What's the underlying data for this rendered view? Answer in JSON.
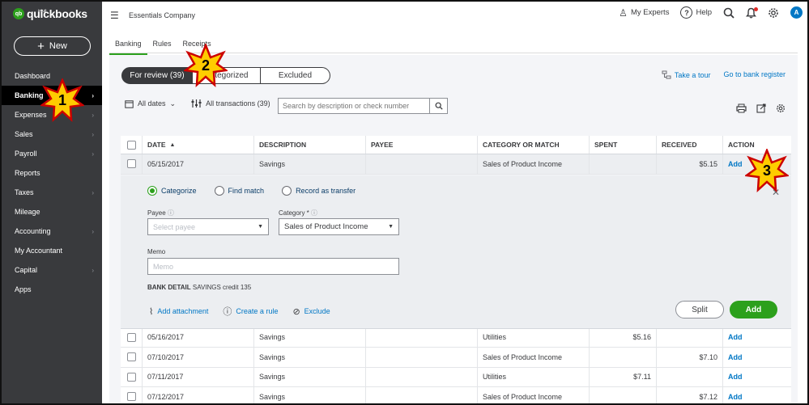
{
  "app": {
    "logo_small": "intuit",
    "logo_text": "quickbooks",
    "logo_mark": "qb"
  },
  "sidebar": {
    "new_label": "New",
    "items": [
      {
        "label": "Dashboard",
        "chevron": false
      },
      {
        "label": "Banking",
        "chevron": true,
        "active": true
      },
      {
        "label": "Expenses",
        "chevron": true
      },
      {
        "label": "Sales",
        "chevron": true
      },
      {
        "label": "Payroll",
        "chevron": true
      },
      {
        "label": "Reports",
        "chevron": false
      },
      {
        "label": "Taxes",
        "chevron": true
      },
      {
        "label": "Mileage",
        "chevron": false
      },
      {
        "label": "Accounting",
        "chevron": true
      },
      {
        "label": "My Accountant",
        "chevron": false
      },
      {
        "label": "Capital",
        "chevron": true
      },
      {
        "label": "Apps",
        "chevron": false
      }
    ]
  },
  "topbar": {
    "company": "Essentials Company",
    "my_experts": "My Experts",
    "help": "Help",
    "avatar_letter": "A"
  },
  "tabs": [
    "Banking",
    "Rules",
    "Receipts"
  ],
  "segments": {
    "for_review": "For review (39)",
    "categorized": "Categorized",
    "excluded": "Excluded"
  },
  "links": {
    "take_tour": "Take a tour",
    "bank_register": "Go to bank register"
  },
  "filters": {
    "all_dates": "All dates",
    "all_transactions": "All transactions (39)",
    "search_placeholder": "Search by description or check number"
  },
  "table": {
    "headers": {
      "date": "DATE",
      "description": "DESCRIPTION",
      "payee": "PAYEE",
      "category": "CATEGORY OR MATCH",
      "spent": "SPENT",
      "received": "RECEIVED",
      "action": "ACTION"
    },
    "selected_row": {
      "date": "05/15/2017",
      "description": "Savings",
      "payee": "",
      "category": "Sales of Product Income",
      "spent": "",
      "received": "$5.15",
      "action": "Add"
    },
    "rows": [
      {
        "date": "05/16/2017",
        "description": "Savings",
        "payee": "",
        "category": "Utilities",
        "spent": "$5.16",
        "received": "",
        "action": "Add"
      },
      {
        "date": "07/10/2017",
        "description": "Savings",
        "payee": "",
        "category": "Sales of Product Income",
        "spent": "",
        "received": "$7.10",
        "action": "Add"
      },
      {
        "date": "07/11/2017",
        "description": "Savings",
        "payee": "",
        "category": "Utilities",
        "spent": "$7.11",
        "received": "",
        "action": "Add"
      },
      {
        "date": "07/12/2017",
        "description": "Savings",
        "payee": "",
        "category": "Sales of Product Income",
        "spent": "",
        "received": "$7.12",
        "action": "Add"
      }
    ]
  },
  "detail": {
    "radio_categorize": "Categorize",
    "radio_find_match": "Find match",
    "radio_transfer": "Record as transfer",
    "payee_label": "Payee",
    "payee_placeholder": "Select payee",
    "category_label": "Category *",
    "category_value": "Sales of Product Income",
    "memo_label": "Memo",
    "memo_placeholder": "Memo",
    "bank_detail_label": "BANK DETAIL",
    "bank_detail_value": "SAVINGS credit 135",
    "add_attachment": "Add attachment",
    "create_rule": "Create a rule",
    "exclude": "Exclude",
    "split": "Split",
    "add": "Add"
  },
  "callouts": [
    "1",
    "2",
    "3"
  ],
  "colors": {
    "sidebar_bg": "#393a3d",
    "accent_green": "#2ca01c",
    "link_blue": "#0077c5",
    "star_fill": "#ffcc00",
    "star_stroke": "#cc0000"
  }
}
